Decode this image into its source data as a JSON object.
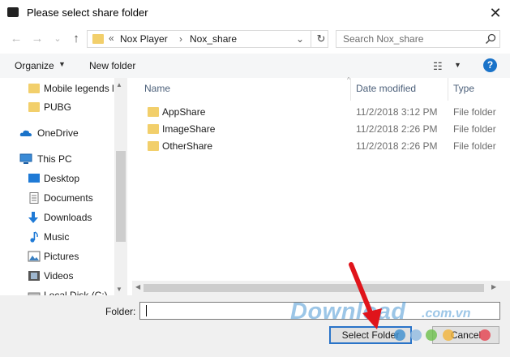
{
  "window": {
    "title": "Please select share folder",
    "close_glyph": "✕"
  },
  "address": {
    "nav_back": "←",
    "nav_forward": "→",
    "nav_recent": "⌄",
    "nav_up": "↑",
    "chevron": "«",
    "crumbs": [
      "Nox Player",
      "Nox_share"
    ],
    "sep": "›",
    "refresh": "↻"
  },
  "search": {
    "placeholder": "Search Nox_share"
  },
  "toolbar": {
    "organize": "Organize",
    "new_folder": "New folder",
    "view_glyph": "☷",
    "caret": "▼",
    "help": "?"
  },
  "sidebar": {
    "items": [
      {
        "label": "Mobile legends l",
        "icon": "folder-icon"
      },
      {
        "label": "PUBG",
        "icon": "folder-icon"
      },
      {
        "label": "OneDrive",
        "icon": "cloud-icon"
      },
      {
        "label": "This PC",
        "icon": "computer-icon"
      },
      {
        "label": "Desktop",
        "icon": "desktop-icon"
      },
      {
        "label": "Documents",
        "icon": "document-icon"
      },
      {
        "label": "Downloads",
        "icon": "download-icon"
      },
      {
        "label": "Music",
        "icon": "music-icon"
      },
      {
        "label": "Pictures",
        "icon": "pictures-icon"
      },
      {
        "label": "Videos",
        "icon": "videos-icon"
      },
      {
        "label": "Local Disk (C:)",
        "icon": "disk-icon"
      }
    ]
  },
  "files": {
    "columns": {
      "name": "Name",
      "date": "Date modified",
      "type": "Type"
    },
    "sort_caret": "^",
    "rows": [
      {
        "name": "AppShare",
        "date": "11/2/2018 3:12 PM",
        "type": "File folder"
      },
      {
        "name": "ImageShare",
        "date": "11/2/2018 2:26 PM",
        "type": "File folder"
      },
      {
        "name": "OtherShare",
        "date": "11/2/2018 2:26 PM",
        "type": "File folder"
      }
    ]
  },
  "footer": {
    "folder_label": "Folder:",
    "folder_value": "",
    "select_button": "Select Folder",
    "cancel_button": "Cancel"
  },
  "watermark": {
    "text": "Download",
    "suffix": ".com.vn"
  },
  "colors": {
    "accent": "#1a73c9",
    "folder": "#f2cf6b",
    "arrow": "#e0141b"
  }
}
